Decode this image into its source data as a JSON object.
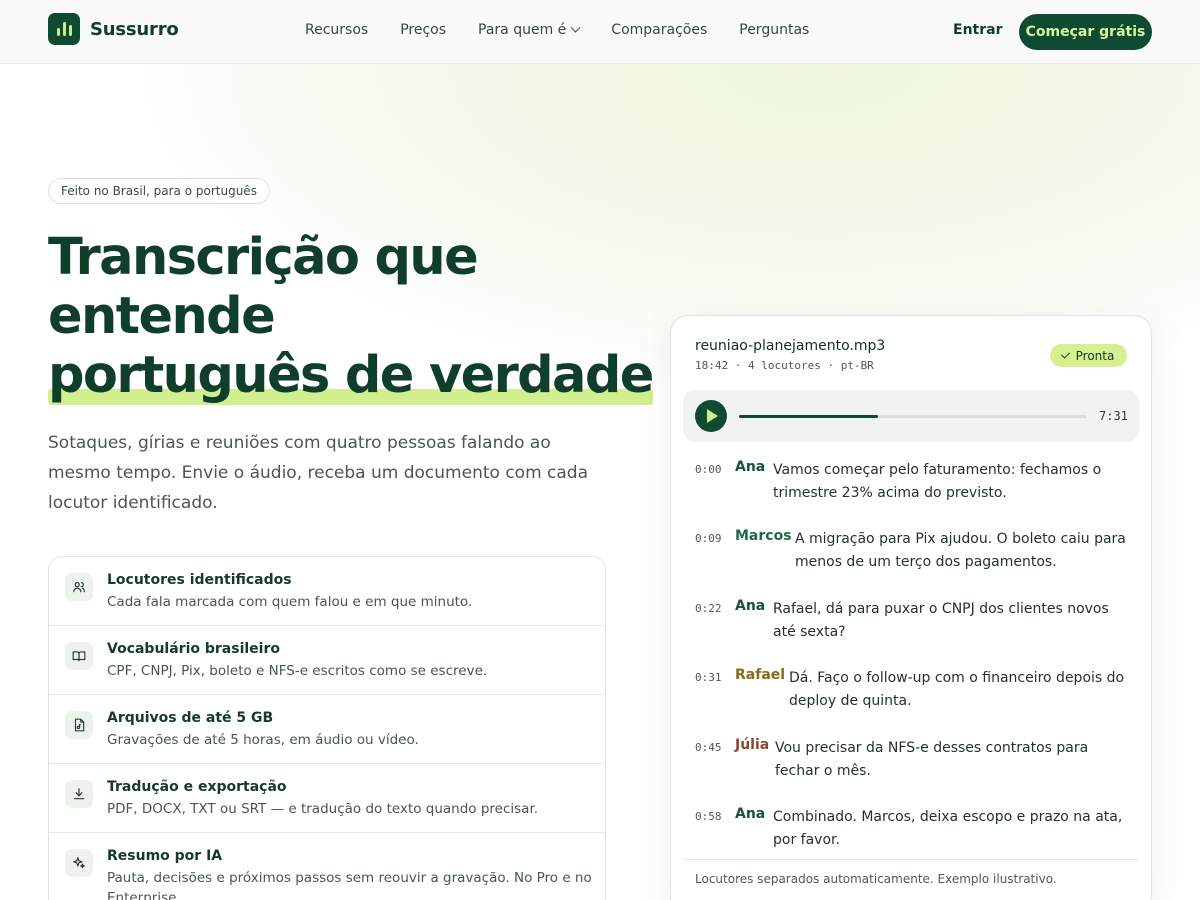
{
  "brand": {
    "name": "Sussurro",
    "logo_icon": "audio-bars-icon"
  },
  "nav": {
    "items": [
      {
        "label": "Recursos"
      },
      {
        "label": "Preços"
      },
      {
        "label": "Para quem é",
        "dropdown": true
      },
      {
        "label": "Comparações"
      },
      {
        "label": "Perguntas"
      }
    ],
    "login": "Entrar",
    "cta": "Começar grátis"
  },
  "hero": {
    "badge": "Feito no Brasil, para o português",
    "title_line1": "Transcrição que",
    "title_line2": "entende",
    "title_line3": "português de verdade",
    "lead": "Sotaques, gírias e reuniões com quatro pessoas falando ao mesmo tempo. Envie o áudio, receba um documento com cada locutor identificado."
  },
  "features": [
    {
      "icon": "users-icon",
      "title": "Locutores identificados",
      "desc": "Cada fala marcada com quem falou e em que minuto."
    },
    {
      "icon": "book-icon",
      "title": "Vocabulário brasileiro",
      "desc": "CPF, CNPJ, Pix, boleto e NFS-e escritos como se escreve."
    },
    {
      "icon": "file-audio-icon",
      "title": "Arquivos de até 5 GB",
      "desc": "Gravações de até 5 horas, em áudio ou vídeo."
    },
    {
      "icon": "download-icon",
      "title": "Tradução e exportação",
      "desc": "PDF, DOCX, TXT ou SRT — e tradução do texto quando precisar."
    },
    {
      "icon": "sparkles-icon",
      "title": "Resumo por IA",
      "desc": "Pauta, decisões e próximos passos sem reouvir a gravação. No Pro e no Enterprise."
    }
  ],
  "transcript": {
    "file_name": "reuniao-planejamento.mp3",
    "meta": "18:42 · 4 locutores · pt-BR",
    "status": "Pronta",
    "player": {
      "duration": "7:31",
      "progress": 0.4
    },
    "colors": {
      "green": "#14553a",
      "gold": "#8a6a12",
      "brown": "#8a4a28"
    },
    "segments": [
      {
        "time": "0:00",
        "speaker": "Ana",
        "color": "#14553a",
        "text": "Vamos começar pelo faturamento: fechamos o trimestre 23% acima do previsto."
      },
      {
        "time": "0:09",
        "speaker": "Marcos",
        "color": "#1d6a44",
        "text": "A migração para Pix ajudou. O boleto caiu para menos de um terço dos pagamentos."
      },
      {
        "time": "0:22",
        "speaker": "Ana",
        "color": "#14553a",
        "text": "Rafael, dá para puxar o CNPJ dos clientes novos até sexta?"
      },
      {
        "time": "0:31",
        "speaker": "Rafael",
        "color": "#8a6a12",
        "text": "Dá. Faço o follow-up com o financeiro depois do deploy de quinta."
      },
      {
        "time": "0:45",
        "speaker": "Júlia",
        "color": "#8a4a28",
        "text": "Vou precisar da NFS-e desses contratos para fechar o mês."
      },
      {
        "time": "0:58",
        "speaker": "Ana",
        "color": "#14553a",
        "text": "Combinado. Marcos, deixa escopo e prazo na ata, por favor."
      }
    ],
    "footer": "Locutores separados automaticamente. Exemplo ilustrativo."
  }
}
